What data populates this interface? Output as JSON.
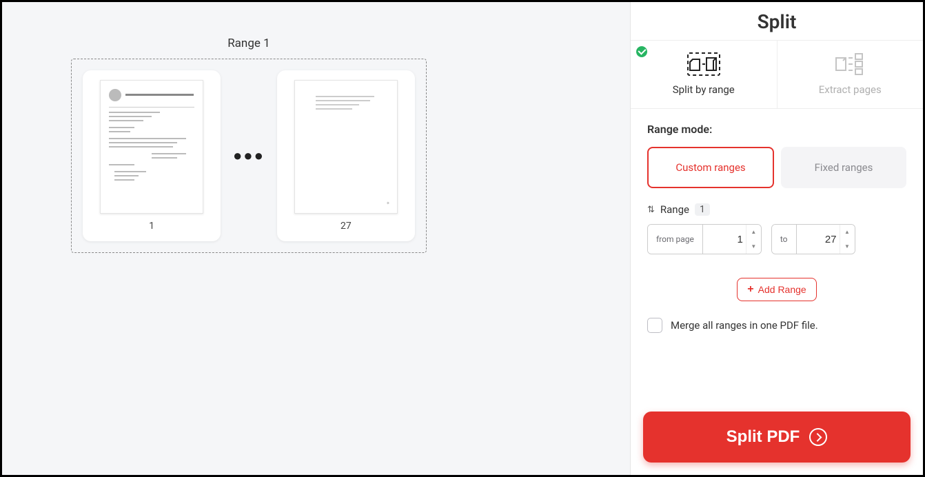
{
  "preview": {
    "range_label": "Range 1",
    "thumbs": [
      {
        "page_number": "1"
      },
      {
        "page_number": "27"
      }
    ],
    "ellipsis": "●●●"
  },
  "sidebar": {
    "title": "Split",
    "tabs": {
      "split_by_range": "Split by range",
      "extract_pages": "Extract pages"
    },
    "range_mode_label": "Range mode:",
    "mode_custom": "Custom ranges",
    "mode_fixed": "Fixed ranges",
    "range_word": "Range",
    "range_number": "1",
    "from_label": "from page",
    "to_label": "to",
    "from_value": "1",
    "to_value": "27",
    "add_range": "Add Range",
    "merge_label": "Merge all ranges in one PDF file.",
    "split_button": "Split PDF"
  },
  "colors": {
    "accent": "#e5322d",
    "success": "#27b562"
  }
}
